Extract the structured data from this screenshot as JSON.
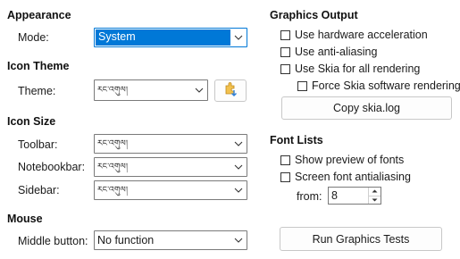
{
  "appearance": {
    "heading": "Appearance",
    "mode_label": "Mode:",
    "mode_value": "System"
  },
  "icon_theme": {
    "heading": "Icon Theme",
    "theme_label": "Theme:",
    "theme_value": "རང་འགུལ།"
  },
  "icon_size": {
    "heading": "Icon Size",
    "toolbar_label": "Toolbar:",
    "toolbar_value": "རང་འགུལ།",
    "notebookbar_label": "Notebookbar:",
    "notebookbar_value": "རང་འགུལ།",
    "sidebar_label": "Sidebar:",
    "sidebar_value": "རང་འགུལ།"
  },
  "mouse": {
    "heading": "Mouse",
    "middle_button_label": "Middle button:",
    "middle_button_value": "No function"
  },
  "graphics_output": {
    "heading": "Graphics Output",
    "hardware_acceleration": "Use hardware acceleration",
    "anti_aliasing": "Use anti-aliasing",
    "skia_all": "Use Skia for all rendering",
    "force_skia_software": "Force Skia software rendering",
    "copy_skia_log": "Copy skia.log"
  },
  "font_lists": {
    "heading": "Font Lists",
    "show_preview": "Show preview of fonts",
    "screen_antialiasing": "Screen font antialiasing",
    "from_label": "from:",
    "from_value": "8"
  },
  "run_tests_button": "Run Graphics Tests",
  "colors": {
    "selection": "#0078d7",
    "border": "#7a7a7a"
  },
  "icons": {
    "dropdown": "chevron-down-icon",
    "add_theme": "add-extension-icon",
    "spin_up": "spin-up-icon",
    "spin_down": "spin-down-icon"
  }
}
